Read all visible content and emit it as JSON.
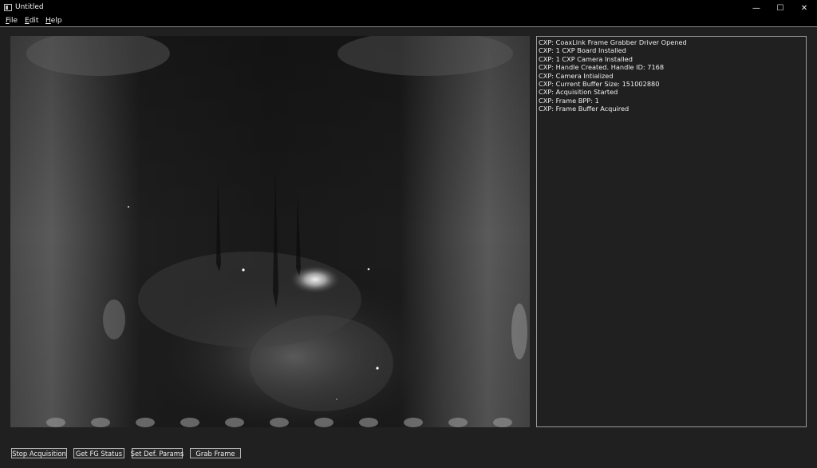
{
  "window": {
    "title": "Untitled",
    "controls": {
      "minimize": "—",
      "maximize": "☐",
      "close": "✕"
    }
  },
  "menu": {
    "file": {
      "accel": "F",
      "rest": "ile"
    },
    "edit": {
      "accel": "E",
      "rest": "dit"
    },
    "help": {
      "accel": "H",
      "rest": "elp"
    }
  },
  "log": {
    "lines": [
      "CXP: CoaxLink Frame Grabber Driver Opened",
      "CXP: 1 CXP Board Installed",
      "CXP: 1 CXP Camera Installed",
      "CXP: Handle Created. Handle ID: 7168",
      "CXP: Camera Intialized",
      "CXP: Current Buffer Size: 151002880",
      "CXP: Acquisition Started",
      "CXP: Frame BPP: 1",
      "CXP: Frame Buffer Acquired"
    ]
  },
  "buttons": {
    "stop_acquisition": "Stop Acquisition",
    "get_fg_status": "Get FG Status",
    "set_def_params": "Set Def. Params",
    "grab_frame": "Grab Frame"
  },
  "colors": {
    "background": "#202020",
    "titlebar": "#000000",
    "text": "#efefef",
    "border": "#9a9a9a"
  },
  "icons": {
    "app": "window-app-icon",
    "minimize": "minimize-icon",
    "maximize": "maximize-icon",
    "close": "close-icon"
  }
}
